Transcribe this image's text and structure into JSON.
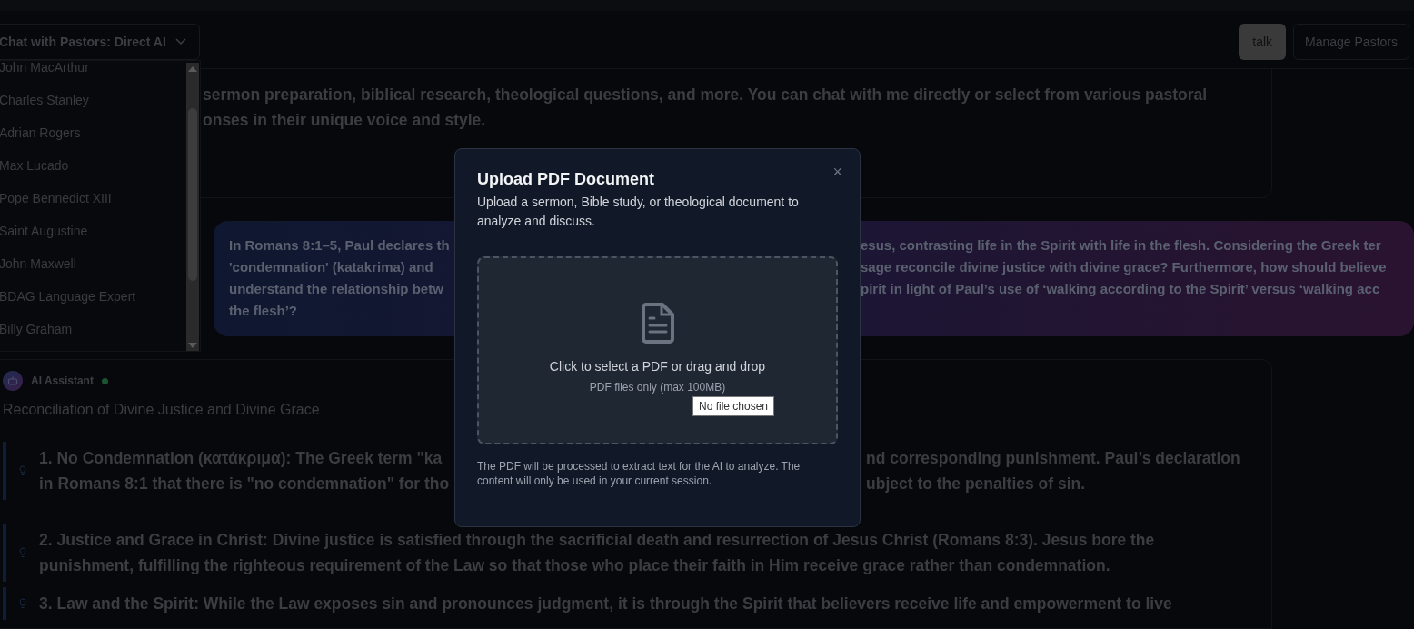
{
  "header": {
    "mode_select": "Chat with Pastors: Direct AI",
    "buttons": [
      {
        "label": "talk",
        "kind": "filled"
      },
      {
        "label": "Manage Pastors",
        "kind": "outline"
      }
    ]
  },
  "pastor_menu": {
    "items": [
      "John MacArthur",
      "Charles Stanley",
      "Adrian Rogers",
      "Max Lucado",
      "Pope Bennedict XIII",
      "Saint Augustine",
      "John Maxwell",
      "BDAG Language Expert",
      "Billy Graham"
    ]
  },
  "intro_message": {
    "lines": [
      "sermon preparation, biblical research, theological questions, and more. You can chat with me directly or select from various pastoral",
      "onses in their unique voice and style."
    ]
  },
  "user_message": {
    "lines": [
      {
        "left": "In Romans 8:1–5, Paul declares th",
        "right": "esus, contrasting life in the Spirit with life in the flesh. Considering the Greek ter"
      },
      {
        "left": "'condemnation' (katakrima) and",
        "right": "sage reconcile divine justice with divine grace? Furthermore, how should believe"
      },
      {
        "left": "understand the relationship betw",
        "right": "pirit in light of Paul’s use of ‘walking according to the Spirit’ versus ‘walking acc"
      },
      {
        "left": "the flesh’?"
      }
    ]
  },
  "assistant_message": {
    "sender": "AI Assistant",
    "online": true,
    "heading": "Reconciliation of Divine Justice and Divine Grace",
    "points": [
      {
        "lines": [
          {
            "left": "1. No Condemnation (κατάκριμα): The Greek term \"ka",
            "right": "nd corresponding punishment. Paul’s declaration"
          },
          {
            "left": "in Romans 8:1 that there is \"no condemnation\" for tho",
            "right": "ubject to the penalties of sin."
          }
        ]
      },
      {
        "lines": [
          {
            "left": "2. Justice and Grace in Christ: Divine justice is satisfied through the sacrificial death and resurrection of Jesus Christ (Romans 8:3). Jesus bore the"
          },
          {
            "left": "punishment, fulfilling the righteous requirement of the Law so that those who place their faith in Him receive grace rather than condemnation."
          }
        ]
      },
      {
        "lines": [
          {
            "left": "3. Law and the Spirit: While the Law exposes sin and pronounces judgment, it is through the Spirit that believers receive life and empowerment to live"
          }
        ]
      }
    ]
  },
  "upload_dialog": {
    "title": "Upload PDF Document",
    "description": "Upload a sermon, Bible study, or theological document to analyze and discuss.",
    "close": "×",
    "dropzone_text": "Click to select a PDF or drag and drop",
    "dropzone_hint": "PDF files only (max 100MB)",
    "file_tooltip": "No file chosen",
    "note": "The PDF will be processed to extract text for the AI to analyze. The content will only be used in your current session."
  }
}
